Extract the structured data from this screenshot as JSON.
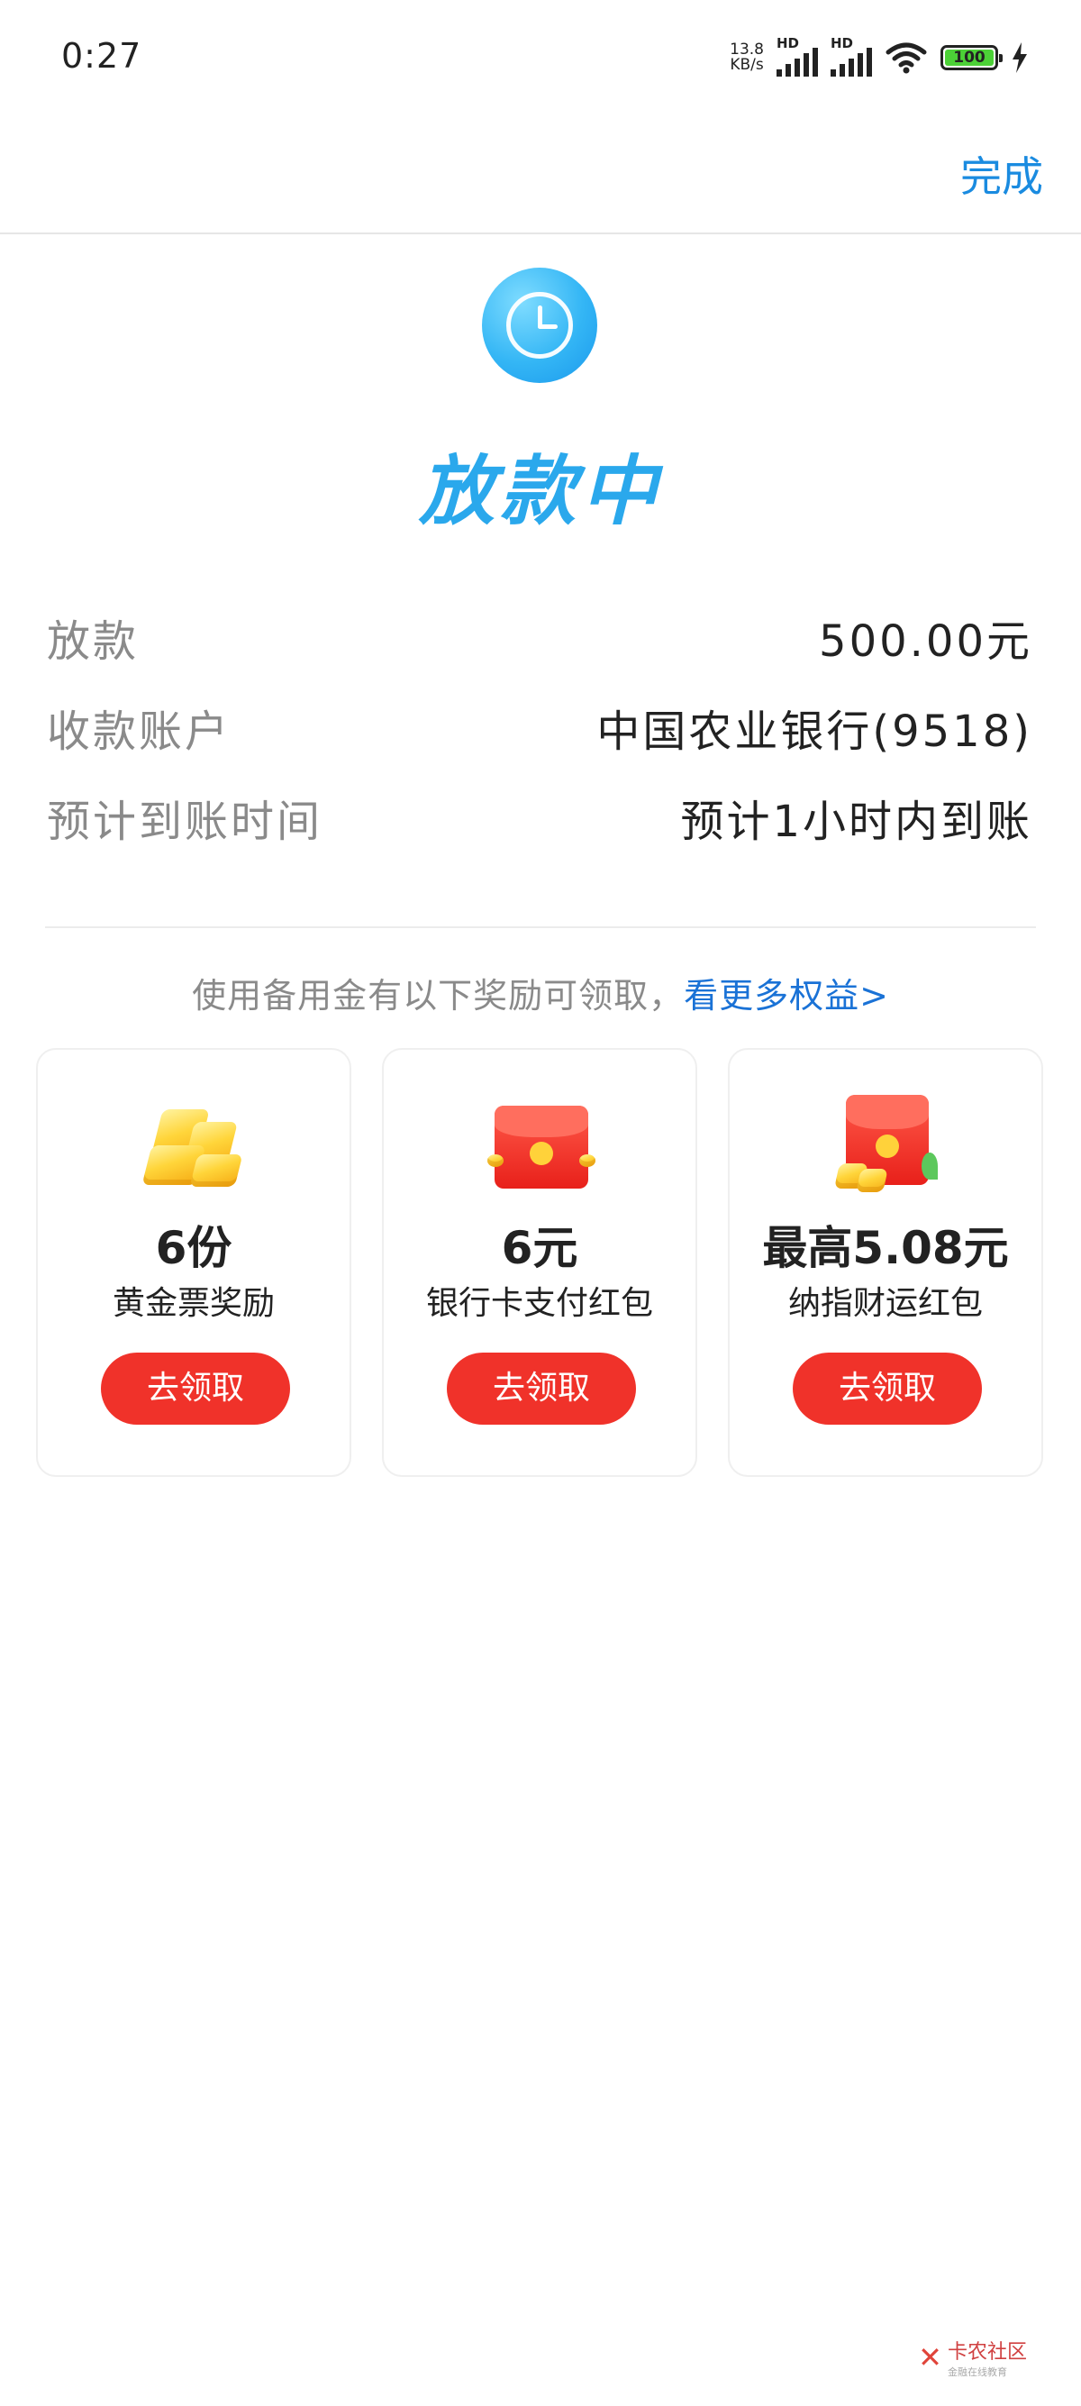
{
  "status_bar": {
    "time": "0:27",
    "net_speed_value": "13.8",
    "net_speed_unit": "KB/s",
    "sim1_label": "HD",
    "sim2_label": "HD",
    "battery": "100"
  },
  "nav": {
    "done_label": "完成"
  },
  "header": {
    "status_title": "放款中",
    "status_icon": "clock-icon"
  },
  "details": [
    {
      "label": "放款",
      "value": "500.00元"
    },
    {
      "label": "收款账户",
      "value": "中国农业银行(9518)"
    },
    {
      "label": "预计到账时间",
      "value": "预计1小时内到账"
    }
  ],
  "promo": {
    "text": "使用备用金有以下奖励可领取，",
    "link": "看更多权益>"
  },
  "rewards": [
    {
      "amount": "6份",
      "desc": "黄金票奖励",
      "button": "去领取",
      "icon": "gold-bar-icon"
    },
    {
      "amount": "6元",
      "desc": "银行卡支付红包",
      "button": "去领取",
      "icon": "red-envelope-icon"
    },
    {
      "amount": "最高5.08元",
      "desc": "纳指财运红包",
      "button": "去领取",
      "icon": "red-envelope-gold-icon"
    }
  ],
  "watermark": {
    "text": "卡农社区",
    "subtext": "金融在线教育"
  },
  "colors": {
    "accent": "#1a8be0",
    "title": "#2aa8ec",
    "button": "#f0322a"
  }
}
